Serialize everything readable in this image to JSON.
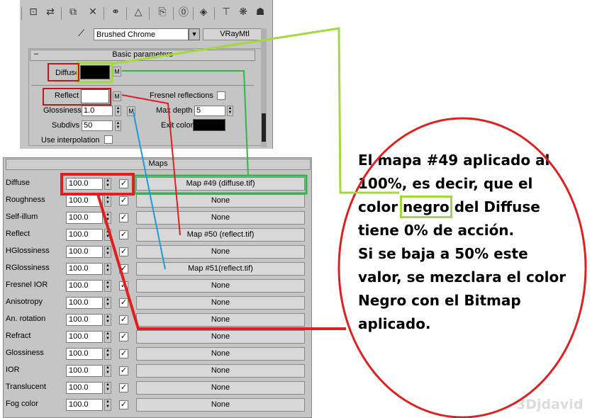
{
  "toolbar": {
    "icons": [
      "pick-material-icon",
      "put-material-icon",
      "assign-material-icon",
      "delete-icon",
      "make-unique-icon",
      "sample-icon",
      "copy-icon",
      "material-id-icon",
      "show-map-icon",
      "settings-icon",
      "options-icon",
      "go-parent-icon"
    ]
  },
  "material": {
    "name": "Brushed Chrome",
    "type": "VRayMtl"
  },
  "basic_params": {
    "title": "Basic parameters",
    "minus": "–",
    "diffuse_label": "Diffuse",
    "m_label": "M",
    "reflect_label": "Reflect",
    "fresnel_label": "Fresnel reflections",
    "glossiness_label": "Glossiness",
    "glossiness_value": "1.0",
    "maxdepth_label": "Max depth",
    "maxdepth_value": "5",
    "subdivs_label": "Subdivs",
    "subdivs_value": "50",
    "exitcolor_label": "Exit color",
    "interp_label": "Use interpolation"
  },
  "maps": {
    "title": "Maps",
    "rows": [
      {
        "label": "Diffuse",
        "value": "100.0",
        "map": "Map #49 (diffuse.tif)"
      },
      {
        "label": "Roughness",
        "value": "100.0",
        "map": "None"
      },
      {
        "label": "Self-illum",
        "value": "100.0",
        "map": "None"
      },
      {
        "label": "Reflect",
        "value": "100.0",
        "map": "Map #50 (reflect.tif)"
      },
      {
        "label": "HGlossiness",
        "value": "100.0",
        "map": "None"
      },
      {
        "label": "RGlossiness",
        "value": "100.0",
        "map": "Map #51(reflect.tif)"
      },
      {
        "label": "Fresnel IOR",
        "value": "100.0",
        "map": "None"
      },
      {
        "label": "Anisotropy",
        "value": "100.0",
        "map": "None"
      },
      {
        "label": "An. rotation",
        "value": "100.0",
        "map": "None"
      },
      {
        "label": "Refract",
        "value": "100.0",
        "map": "None"
      },
      {
        "label": "Glossiness",
        "value": "100.0",
        "map": "None"
      },
      {
        "label": "IOR",
        "value": "100.0",
        "map": "None"
      },
      {
        "label": "Translucent",
        "value": "100.0",
        "map": "None"
      },
      {
        "label": "Fog color",
        "value": "100.0",
        "map": "None"
      }
    ]
  },
  "annotation": {
    "line1_a": "El mapa #49 aplicado al 100%, es decir, que el color ",
    "line1_hl": "negro",
    "line1_b": " del Diffuse tiene 0% de acción.",
    "line2": "Si se baja a 50% este valor, se mezclara el color Negro con el Bitmap aplicado."
  },
  "watermark": "3Djdavid",
  "colors": {
    "lime": "#a4d93a",
    "red": "#e02020",
    "green": "#2fb84a",
    "blue": "#1e9bd8"
  }
}
